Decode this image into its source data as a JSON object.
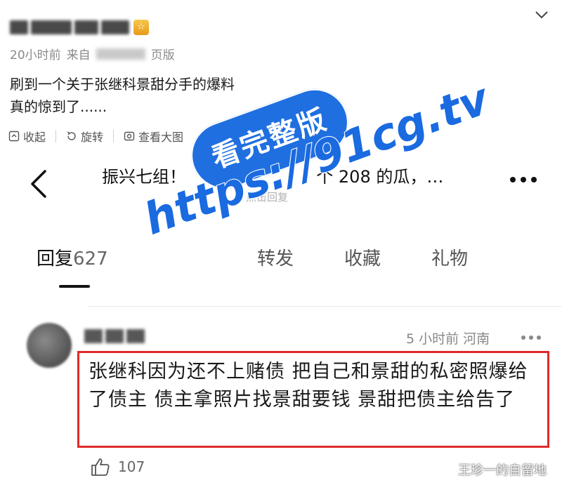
{
  "post": {
    "meta_age": "20小时前",
    "meta_from": "来自",
    "meta_client_suffix": "页版",
    "body_line1": "刷到一个关于张继科景甜分手的爆料",
    "body_line2": "真的惊到了......",
    "actions": {
      "collapse": "收起",
      "rotate": "旋转",
      "view_large": "查看大图"
    }
  },
  "screenshot": {
    "title": "振兴七组！",
    "title_tail": "个 208 的瓜，…",
    "subtitle": "点击回复",
    "tabs": [
      {
        "label": "回复",
        "count": "627"
      },
      {
        "label": "转发"
      },
      {
        "label": "收藏"
      },
      {
        "label": "礼物"
      }
    ],
    "comment": {
      "time": "5 小时前 河南",
      "text": "张继科因为还不上赌债 把自己和景甜的私密照爆给了债主 债主拿照片找景甜要钱 景甜把债主给告了",
      "likes": "107"
    }
  },
  "overlay": {
    "promo_label": "看完整版",
    "promo_url": "https://91cg.tv",
    "watermark": "王珍一的自留地"
  },
  "colors": {
    "highlight_border": "#e02a2a",
    "promo_blue": "#1f6fe0"
  }
}
